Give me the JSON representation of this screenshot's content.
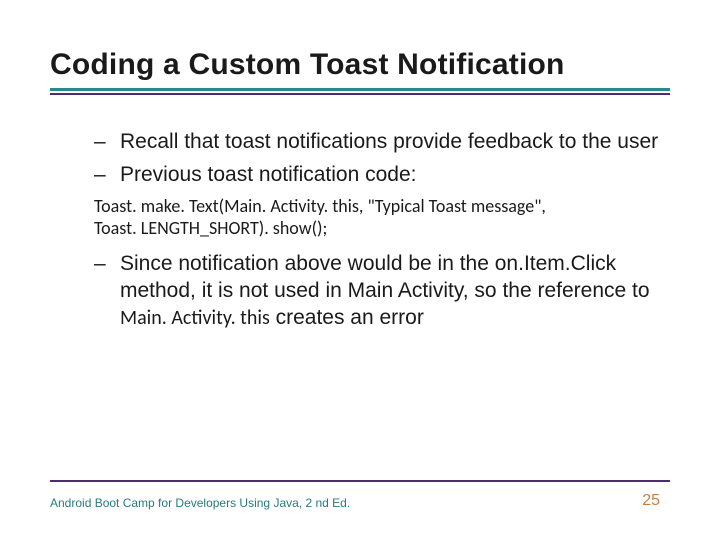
{
  "title": "Coding a Custom Toast Notification",
  "bullets": {
    "b1": "Recall that toast notifications provide feedback to the user",
    "b2": "Previous toast notification code:",
    "b3_pre": "Since notification above would be in the on.Item.Click method, it is not used in Main Activity, so the reference to ",
    "b3_mono": "Main. Activity. this",
    "b3_post": " creates an error"
  },
  "code": {
    "line1": "Toast. make. Text(Main. Activity. this, \"Typical Toast message\",",
    "line2": "Toast. LENGTH_SHORT). show();"
  },
  "footer": "Android Boot Camp for Developers Using Java, 2 nd Ed.",
  "page": "25"
}
